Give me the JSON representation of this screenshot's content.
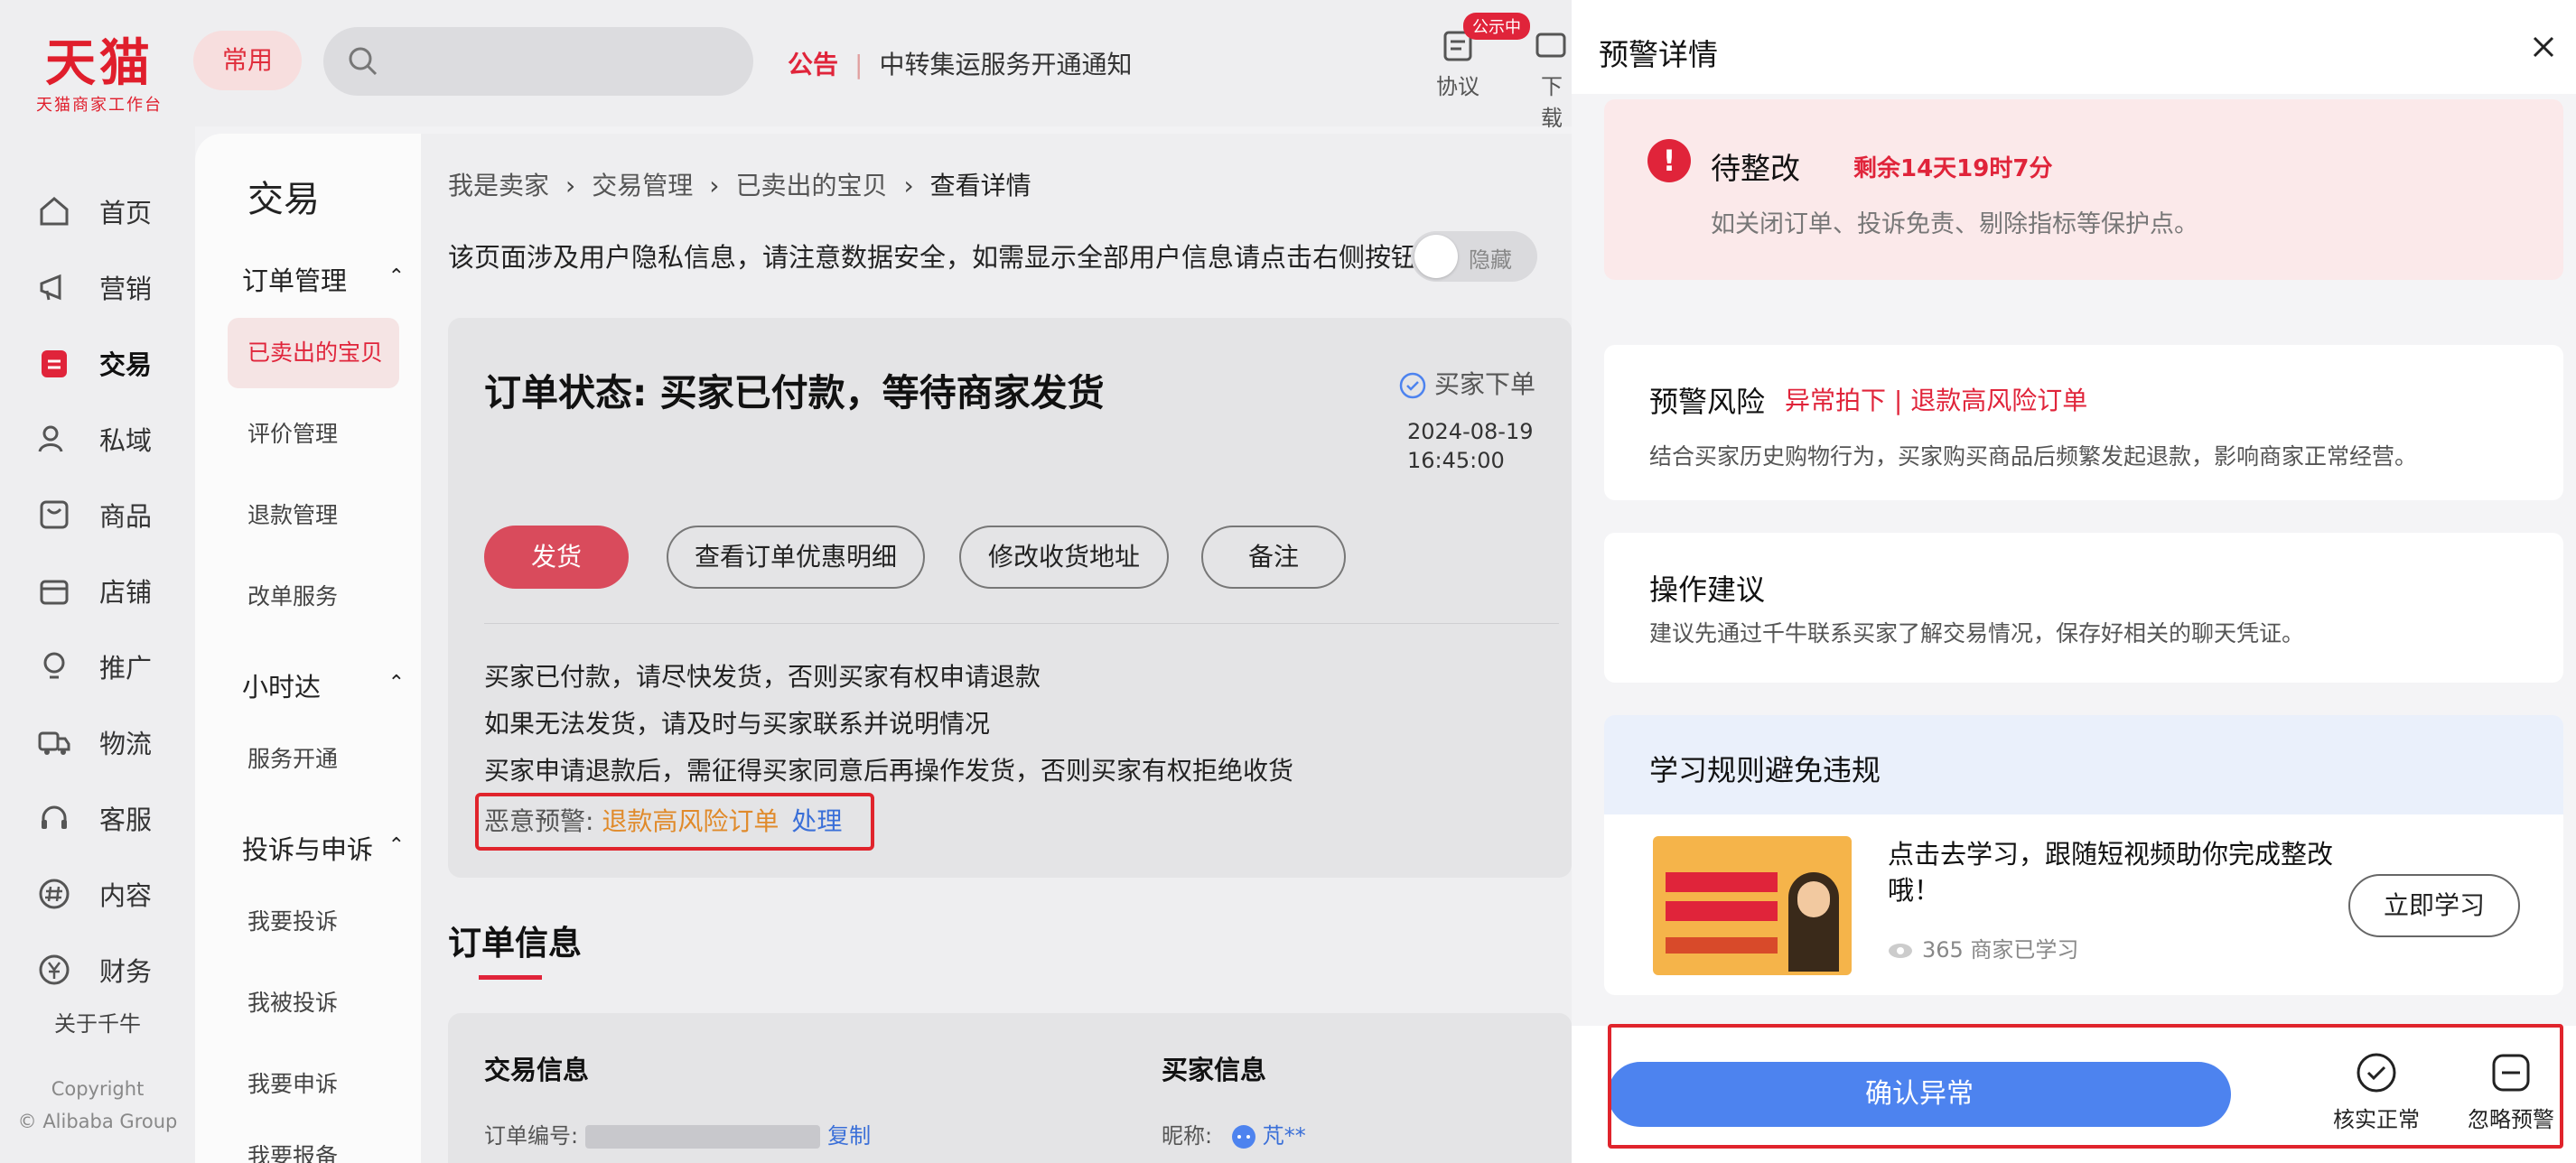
{
  "brand": {
    "logo_main": "天猫",
    "logo_sub": "天猫商家工作台"
  },
  "header": {
    "common_label": "常用",
    "search_placeholder": "",
    "notice_tag": "公告",
    "notice_text": "中转集运服务开通通知",
    "tools": [
      {
        "label": "协议",
        "badge": "公示中",
        "icon": "protocol-icon"
      },
      {
        "label": "下载",
        "icon": "download-icon"
      }
    ]
  },
  "leftnav": {
    "items": [
      {
        "label": "首页",
        "icon": "home-icon"
      },
      {
        "label": "营销",
        "icon": "megaphone-icon"
      },
      {
        "label": "交易",
        "icon": "trade-icon",
        "active": true
      },
      {
        "label": "私域",
        "icon": "users-icon"
      },
      {
        "label": "商品",
        "icon": "goods-icon"
      },
      {
        "label": "店铺",
        "icon": "store-icon"
      },
      {
        "label": "推广",
        "icon": "bulb-icon"
      },
      {
        "label": "物流",
        "icon": "truck-icon"
      },
      {
        "label": "客服",
        "icon": "headset-icon"
      },
      {
        "label": "内容",
        "icon": "hash-icon"
      },
      {
        "label": "财务",
        "icon": "yen-icon"
      }
    ],
    "about": "关于千牛",
    "copyright_1": "Copyright",
    "copyright_2": "© Alibaba Group"
  },
  "subnav": {
    "title": "交易",
    "groups": [
      {
        "label": "订单管理",
        "items": [
          "已卖出的宝贝",
          "评价管理",
          "退款管理",
          "改单服务"
        ]
      },
      {
        "label": "小时达",
        "items": [
          "服务开通"
        ]
      },
      {
        "label": "投诉与申诉",
        "items": [
          "我要投诉",
          "我被投诉",
          "我要申诉",
          "我要报备"
        ]
      }
    ]
  },
  "main": {
    "breadcrumb": [
      "我是卖家",
      "交易管理",
      "已卖出的宝贝",
      "查看详情"
    ],
    "privacy_text": "该页面涉及用户隐私信息，请注意数据安全，如需显示全部用户信息请点击右侧按钮",
    "toggle_label": "隐藏",
    "status_title": "订单状态: 买家已付款，等待商家发货",
    "step_label": "买家下单",
    "step_date": "2024-08-19",
    "step_time": "16:45:00",
    "buttons": [
      "发货",
      "查看订单优惠明细",
      "修改收货地址",
      "备注"
    ],
    "lines": [
      "买家已付款，请尽快发货，否则买家有权申请退款",
      "如果无法发货，请及时与买家联系并说明情况",
      "买家申请退款后，需征得买家同意后再操作发货，否则买家有权拒绝收货"
    ],
    "warning_prefix": "恶意预警:",
    "warning_value": "退款高风险订单",
    "warning_action": "处理",
    "section_title": "订单信息",
    "trade_info_title": "交易信息",
    "buyer_info_title": "买家信息",
    "order_no_label": "订单编号:",
    "copy_label": "复制",
    "nick_label": "昵称:",
    "nick_value": "芃**"
  },
  "drawer": {
    "title": "预警详情",
    "alert_status": "待整改",
    "alert_remaining": "剩余14天19时7分",
    "alert_desc": "如关闭订单、投诉免责、剔除指标等保护点。",
    "risk_title": "预警风险",
    "risk_value": "异常拍下 | 退款高风险订单",
    "risk_desc": "结合买家历史购物行为，买家购买商品后频繁发起退款，影响商家正常经营。",
    "advice_title": "操作建议",
    "advice_desc": "建议先通过千牛联系买家了解交易情况，保存好相关的聊天凭证。",
    "learn_title": "学习规则避免违规",
    "learn_item_title": "点击去学习，跟随短视频助你完成整改哦！",
    "learn_views": "365 商家已学习",
    "learn_button": "立即学习",
    "confirm_button": "确认异常",
    "verify_label": "核实正常",
    "ignore_label": "忽略预警"
  },
  "colors": {
    "brand_red": "#e0243a",
    "primary_blue": "#4d83ef",
    "highlight_outline": "#e0242c"
  }
}
